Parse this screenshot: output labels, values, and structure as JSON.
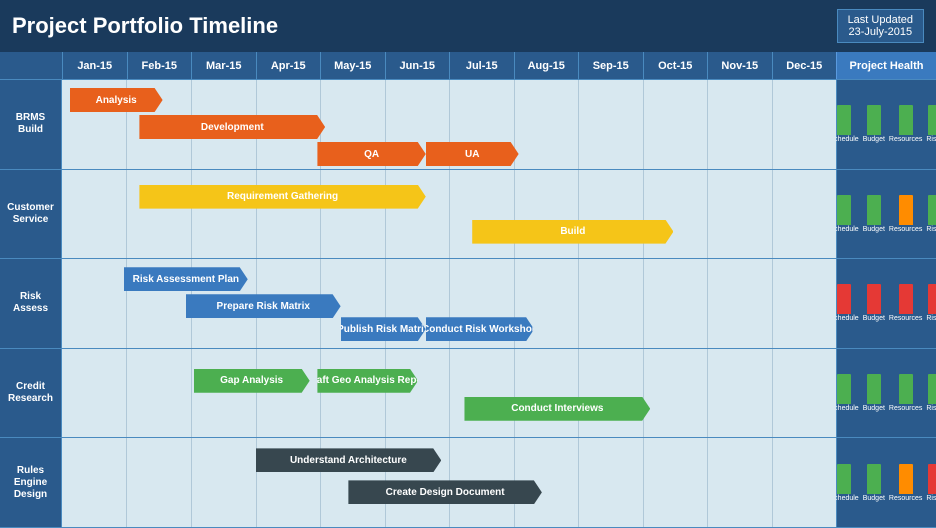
{
  "header": {
    "title": "Project Portfolio Timeline",
    "last_updated_label": "Last Updated",
    "last_updated_date": "23-July-2015"
  },
  "months": [
    "Jan-15",
    "Feb-15",
    "Mar-15",
    "Apr-15",
    "May-15",
    "Jun-15",
    "Jul-15",
    "Aug-15",
    "Sep-15",
    "Oct-15",
    "Nov-15",
    "Dec-15"
  ],
  "project_health_label": "Project Health",
  "health_labels": [
    "Schedule",
    "Budget",
    "Resources",
    "Risks"
  ],
  "rows": [
    {
      "label": "BRMS Build",
      "bars": [
        {
          "label": "Analysis",
          "color": "#e8601c",
          "left_pct": 1,
          "width_pct": 12
        },
        {
          "label": "Development",
          "color": "#e8601c",
          "left_pct": 10,
          "width_pct": 24
        },
        {
          "label": "QA",
          "color": "#e8601c",
          "left_pct": 33,
          "width_pct": 14
        },
        {
          "label": "UA",
          "color": "#e8601c",
          "left_pct": 47,
          "width_pct": 12
        }
      ],
      "health": [
        {
          "color": "green",
          "height": 30
        },
        {
          "color": "green",
          "height": 30
        },
        {
          "color": "green",
          "height": 30
        },
        {
          "color": "green",
          "height": 30
        }
      ]
    },
    {
      "label": "Customer Service",
      "bars": [
        {
          "label": "Requirement Gathering",
          "color": "#f5c518",
          "left_pct": 10,
          "width_pct": 37
        },
        {
          "label": "Build",
          "color": "#f5c518",
          "left_pct": 53,
          "width_pct": 26
        }
      ],
      "health": [
        {
          "color": "green",
          "height": 30
        },
        {
          "color": "green",
          "height": 30
        },
        {
          "color": "orange",
          "height": 30
        },
        {
          "color": "green",
          "height": 30
        }
      ]
    },
    {
      "label": "Risk Assess",
      "bars": [
        {
          "label": "Risk Assessment Plan",
          "color": "#3a7abf",
          "left_pct": 8,
          "width_pct": 16
        },
        {
          "label": "Prepare Risk Matrix",
          "color": "#3a7abf",
          "left_pct": 16,
          "width_pct": 20
        },
        {
          "label": "Publish Risk Matrix",
          "color": "#3a7abf",
          "left_pct": 36,
          "width_pct": 11
        },
        {
          "label": "Conduct Risk Workshop",
          "color": "#3a7abf",
          "left_pct": 47,
          "width_pct": 14
        }
      ],
      "health": [
        {
          "color": "red",
          "height": 30
        },
        {
          "color": "red",
          "height": 30
        },
        {
          "color": "red",
          "height": 30
        },
        {
          "color": "red",
          "height": 30
        }
      ]
    },
    {
      "label": "Credit Research",
      "bars": [
        {
          "label": "Gap Analysis",
          "color": "#4caf50",
          "left_pct": 17,
          "width_pct": 15
        },
        {
          "label": "Draft Geo Analysis Report",
          "color": "#4caf50",
          "left_pct": 33,
          "width_pct": 13
        },
        {
          "label": "Conduct Interviews",
          "color": "#4caf50",
          "left_pct": 52,
          "width_pct": 24
        }
      ],
      "health": [
        {
          "color": "green",
          "height": 30
        },
        {
          "color": "green",
          "height": 30
        },
        {
          "color": "green",
          "height": 30
        },
        {
          "color": "green",
          "height": 30
        }
      ]
    },
    {
      "label": "Rules Engine Design",
      "bars": [
        {
          "label": "Understand Architecture",
          "color": "#37474f",
          "left_pct": 25,
          "width_pct": 24
        },
        {
          "label": "Create Design Document",
          "color": "#37474f",
          "left_pct": 37,
          "width_pct": 25
        }
      ],
      "health": [
        {
          "color": "green",
          "height": 30
        },
        {
          "color": "green",
          "height": 30
        },
        {
          "color": "orange",
          "height": 30
        },
        {
          "color": "red",
          "height": 30
        }
      ]
    }
  ]
}
